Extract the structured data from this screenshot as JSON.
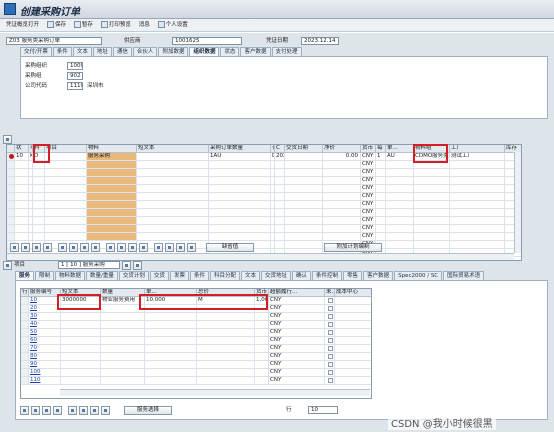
{
  "window": {
    "title": "创建采购订单"
  },
  "toolbar": {
    "items": [
      "凭证概览打开",
      "保存",
      "暂存",
      "打印预览",
      "消息",
      "个人设置"
    ]
  },
  "header": {
    "doc_type": "Z03 服务类采购订单",
    "vendor_label": "供应商",
    "vendor": "1001625",
    "date_label": "凭证日期",
    "date": "2023.12.14",
    "tabs": [
      "交付/开票",
      "条件",
      "文本",
      "地址",
      "通信",
      "合伙人",
      "附加数据",
      "组织数据",
      "状态",
      "客户数据",
      "支付处理"
    ],
    "active_tab": "组织数据",
    "org": [
      {
        "label": "采购组织",
        "value": "1000"
      },
      {
        "label": "采购组",
        "value": "902"
      },
      {
        "label": "公司代码",
        "value": "1110",
        "extra": "深圳市"
      }
    ]
  },
  "items": {
    "columns": [
      "状",
      "项目",
      "科",
      "项目",
      "物料",
      "短文本",
      "采购订单数量",
      "订...",
      "C",
      "交货日期",
      "净价",
      "货币",
      "每",
      "单...",
      "物料组",
      "工厂",
      "库存"
    ],
    "row": {
      "item": "10",
      "acct": "K",
      "cat": "D",
      "short_text": "服务采购",
      "unit": "1AU",
      "c": "D",
      "date": "2023.12.14",
      "price": "0.00",
      "currency": "CNY",
      "per": "1",
      "uom": "AU",
      "mat_group": "CDMO服务类",
      "plant": "测试工厂"
    },
    "currency_default": "CNY",
    "buttons": {
      "default_values": "缺省值",
      "addl_planning": "附加计划编制"
    }
  },
  "detail": {
    "item_label": "项目",
    "item_select": "1 [ 10 ] 服务采购",
    "tabs": [
      "服务",
      "限制",
      "物料数据",
      "数量/重量",
      "交货计划",
      "交货",
      "发票",
      "条件",
      "科目分配",
      "文本",
      "交货地址",
      "确认",
      "条件控制",
      "零售",
      "客户数据",
      "Spec2000 / SC",
      "国际贸易术语"
    ],
    "active_tab": "服务",
    "columns": [
      "行",
      "服务编号",
      "短文本",
      "数量",
      "单...",
      "总价",
      "货币",
      "超额履行...",
      "未...",
      "成本中心",
      ""
    ],
    "rows": [
      {
        "line": "10",
        "service": "3000000",
        "text": "物业服务费用",
        "qty": "10.000",
        "unit": "M",
        "price": "1,000.00",
        "currency": "CNY"
      },
      {
        "line": "20",
        "currency": "CNY"
      },
      {
        "line": "30",
        "currency": "CNY"
      },
      {
        "line": "40",
        "currency": "CNY"
      },
      {
        "line": "50",
        "currency": "CNY"
      },
      {
        "line": "60",
        "currency": "CNY"
      },
      {
        "line": "70",
        "currency": "CNY"
      },
      {
        "line": "80",
        "currency": "CNY"
      },
      {
        "line": "90",
        "currency": "CNY"
      },
      {
        "line": "100",
        "currency": "CNY"
      },
      {
        "line": "110",
        "currency": "CNY"
      }
    ],
    "select_service": "服务选择",
    "row_label": "行",
    "row_value": "10"
  },
  "watermark": "CSDN @我小时候很黑",
  "colors": {
    "accent": "#d21f26",
    "shaded": "#e8b97a",
    "link": "#1d3fa8"
  }
}
